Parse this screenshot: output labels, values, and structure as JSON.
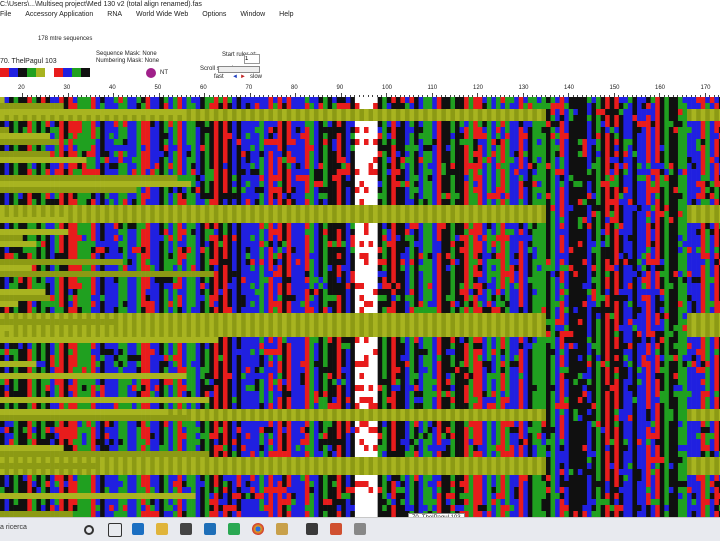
{
  "window": {
    "title": "C:\\Users\\...\\Multiseq project\\Med 130 v2 (total align renamed).fas",
    "menu": [
      "File",
      "Accessory Application",
      "RNA",
      "World Wide Web",
      "Options",
      "Window",
      "Help"
    ]
  },
  "info": {
    "sequences_label": "178 mtre sequences",
    "selected_label": "70. ThelPagul 103",
    "sequence_mask_label": "Sequence Mask: None",
    "numbering_mask_label": "Numbering Mask: None",
    "start_ruler_label": "Start ruler at:",
    "start_ruler_value": "1",
    "scroll_speed_label": "Scroll speed:",
    "scroll_speed_fast": "fast",
    "scroll_speed_slow": "slow"
  },
  "ruler": {
    "ticks": [
      "20",
      "30",
      "40",
      "50",
      "60",
      "70",
      "80",
      "90",
      "100",
      "110",
      "120",
      "130",
      "140",
      "150",
      "160",
      "170"
    ]
  },
  "colors": {
    "A": "#e81c1c",
    "C": "#2020e0",
    "G": "#101010",
    "T": "#20a020",
    "gap": "#8c9a14",
    "gap_light": "#a8b420",
    "selection": "#ffffff"
  },
  "taskbar": {
    "search_text": "a ricerca",
    "icons": [
      "task-view-icon",
      "edge-icon",
      "file-explorer-icon",
      "store-icon",
      "mail-icon",
      "chrome-icon",
      "app-icon",
      "app-icon-2",
      "app-icon-3"
    ]
  },
  "tooltip": "70. ThelPagul 103"
}
